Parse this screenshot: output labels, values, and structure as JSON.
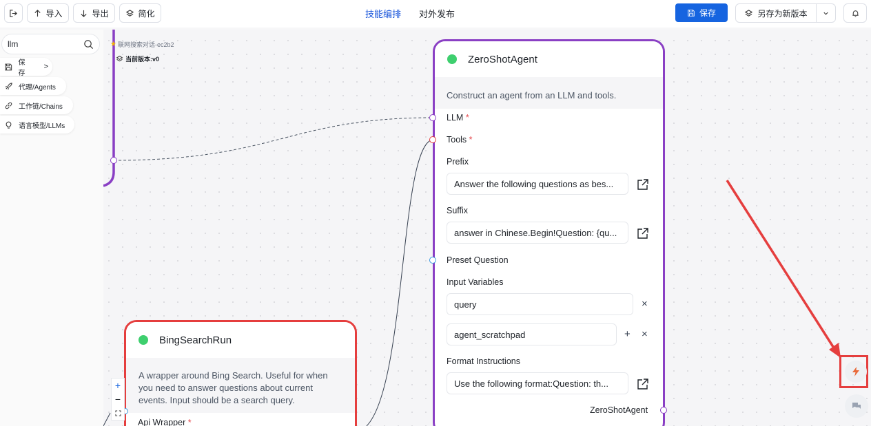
{
  "toolbar": {
    "import_label": "导入",
    "export_label": "导出",
    "simplify_label": "简化",
    "tabs": [
      "技能编排",
      "对外发布"
    ],
    "save_label": "保存",
    "save_as_label": "另存为新版本"
  },
  "sidebar": {
    "search_value": "llm",
    "items": [
      {
        "label": "保存",
        "icon": "save-icon"
      },
      {
        "label": "代理/Agents",
        "icon": "rocket-icon"
      },
      {
        "label": "工作链/Chains",
        "icon": "link-icon"
      },
      {
        "label": "语言模型/LLMs",
        "icon": "lightbulb-icon"
      }
    ]
  },
  "version": {
    "flow_name": "联网搜索对话-ec2b2",
    "current": "当前版本:v0"
  },
  "agent_node": {
    "title": "ZeroShotAgent",
    "description": "Construct an agent from an LLM and tools.",
    "llm_label": "LLM",
    "tools_label": "Tools",
    "prefix_label": "Prefix",
    "prefix_value": "Answer the following questions as bes...",
    "suffix_label": "Suffix",
    "suffix_value": "answer in Chinese.Begin!Question: {qu...",
    "preset_label": "Preset Question",
    "input_vars_label": "Input Variables",
    "input_var_1": "query",
    "input_var_2": "agent_scratchpad",
    "format_label": "Format Instructions",
    "format_value": "Use the following format:Question: th...",
    "output_label": "ZeroShotAgent",
    "required_mark": "*"
  },
  "bing_node": {
    "title": "BingSearchRun",
    "description": "A wrapper around Bing Search. Useful for when you need to answer questions about current events. Input should be a search query.",
    "api_label": "Api Wrapper"
  },
  "zoom": {
    "in": "+",
    "out": "−"
  },
  "colors": {
    "primary": "#1664e0",
    "agent_border": "#8a3fc4",
    "bing_border": "#e53e3e",
    "annotation": "#e53e3e",
    "status_dot": "#3ecf6e"
  }
}
